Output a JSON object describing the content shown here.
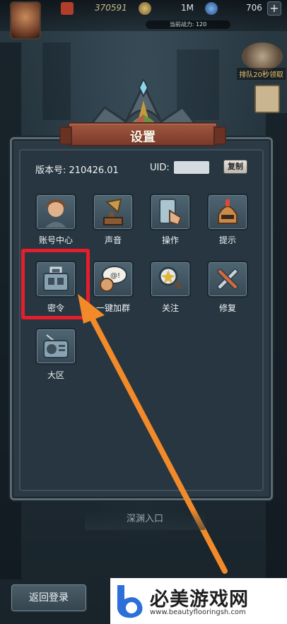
{
  "top_bar": {
    "gold": "370591",
    "resource_1": "1M",
    "resource_2": "706",
    "power_label": "当前战力: 120",
    "add_button": "+"
  },
  "side": {
    "activity_label": "排队20秒领取"
  },
  "settings": {
    "title": "设置",
    "version_label": "版本号: 210426.01",
    "uid_label": "UID:",
    "copy_button": "复制",
    "tiles": [
      {
        "label": "账号中心",
        "icon": "account-portrait-icon"
      },
      {
        "label": "声音",
        "icon": "gramophone-icon"
      },
      {
        "label": "操作",
        "icon": "tap-hand-icon"
      },
      {
        "label": "提示",
        "icon": "helmet-knight-icon"
      },
      {
        "label": "密令",
        "icon": "toolbox-icon",
        "highlighted": true
      },
      {
        "label": "一键加群",
        "icon": "chat-bubble-icon"
      },
      {
        "label": "关注",
        "icon": "magnifier-star-icon"
      },
      {
        "label": "修复",
        "icon": "wrench-screwdriver-icon"
      },
      {
        "label": "大区",
        "icon": "radio-icon"
      }
    ]
  },
  "bottom": {
    "abyss_entrance": "深渊入口",
    "back_login": "返回登录"
  },
  "watermark": {
    "title": "必美游戏网",
    "url": "www.beautyflooringsh.com"
  },
  "colors": {
    "highlight": "#e41e2b",
    "arrow": "#f28a2a",
    "title_plate": "#8e4733"
  }
}
